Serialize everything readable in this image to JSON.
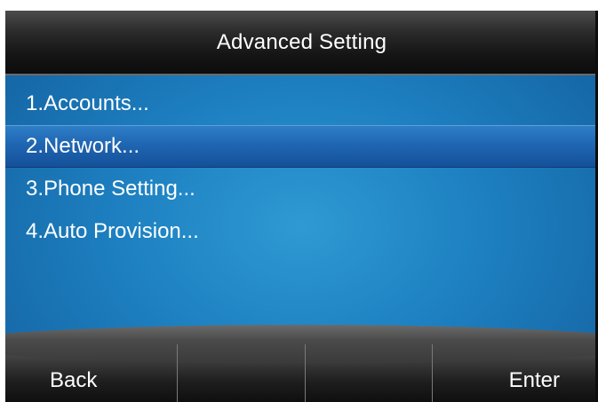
{
  "title": "Advanced Setting",
  "menu": {
    "items": [
      {
        "label": "1.Accounts..."
      },
      {
        "label": "2.Network..."
      },
      {
        "label": "3.Phone Setting..."
      },
      {
        "label": "4.Auto Provision..."
      }
    ],
    "selected_index": 1
  },
  "softkeys": {
    "key1": "Back",
    "key2": "",
    "key3": "",
    "key4": "Enter"
  },
  "colors": {
    "title_bar": "#151515",
    "background": "#1d7fc0",
    "selected_row": "#1f66b2",
    "text": "#ffffff"
  }
}
